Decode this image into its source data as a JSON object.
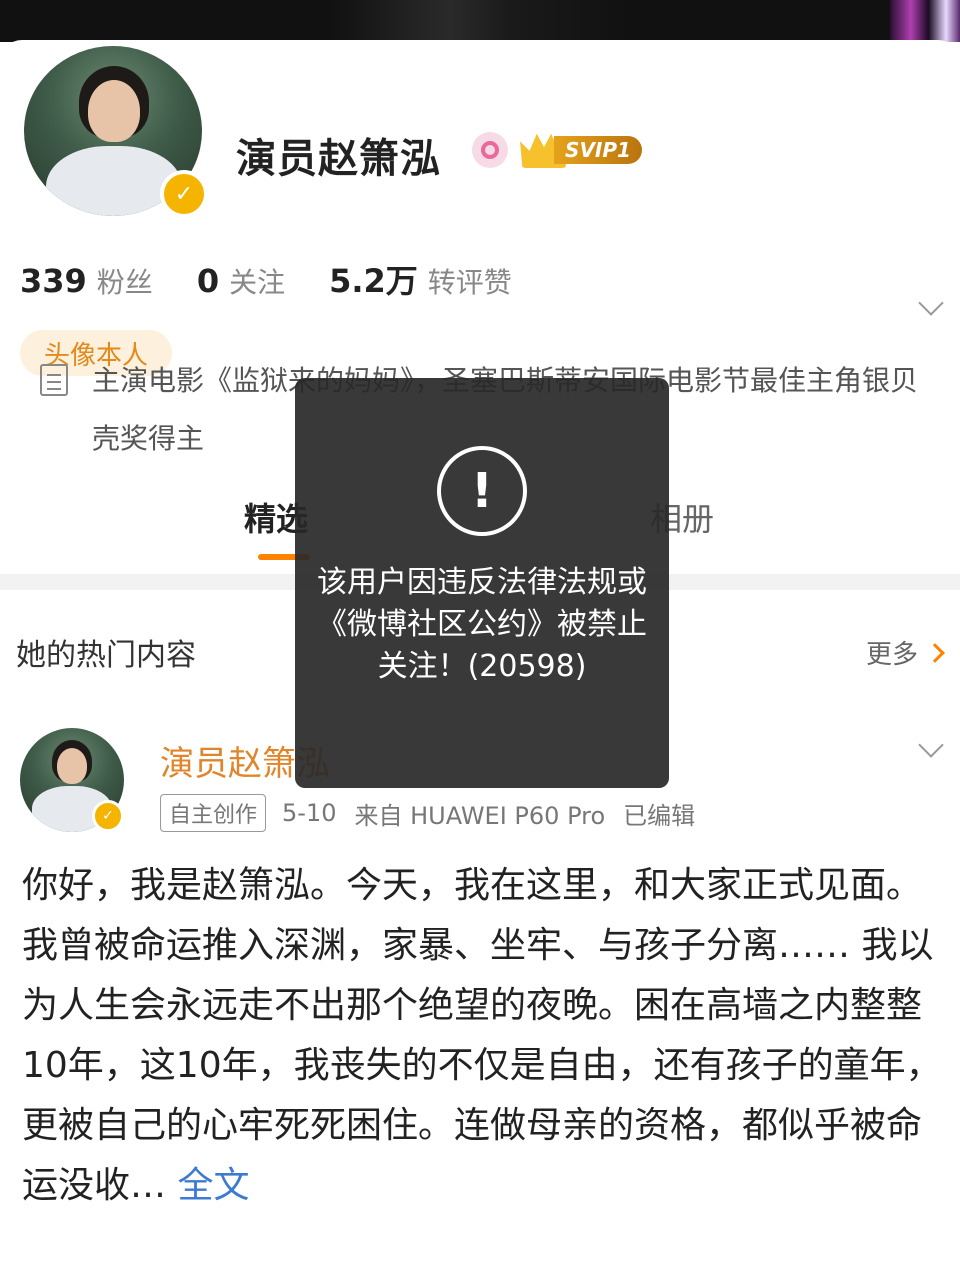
{
  "profile": {
    "username": "演员赵箫泓",
    "vip_label": "SVIP1",
    "stats": [
      {
        "num": "339",
        "label": "粉丝"
      },
      {
        "num": "0",
        "label": "关注"
      },
      {
        "num": "5.2万",
        "label": "转评赞"
      }
    ],
    "tag": "头像本人",
    "bio": "主演电影《监狱来的妈妈》，圣塞巴斯蒂安国际电影节最佳主角银贝壳奖得主"
  },
  "tabs": [
    {
      "label": "精选"
    },
    {
      "label": "相册"
    }
  ],
  "hot": {
    "title": "她的热门内容",
    "more": "更多"
  },
  "post": {
    "author": "演员赵箫泓",
    "badge": "自主创作",
    "date": "5-10",
    "source": "来自 HUAWEI P60 Pro",
    "edited": "已编辑",
    "paragraphs": [
      "你好，我是赵箫泓。今天，我在这里，和大家正式见面。",
      "我曾被命运推入深渊，家暴、坐牢、与孩子分离…… 我以为人生会永远走不出那个绝望的夜晚。困在高墙之内整整10年，这10年，我丧失的不仅是自由，还有孩子的童年，更被自己的心牢死死困住。连做母亲的资格，都似乎被命运没收…"
    ],
    "fulltext": "全文"
  },
  "toast": {
    "icon": "warning-icon",
    "message": "该用户因违反法律法规或《微博社区公约》被禁止关注！(20598)"
  },
  "colors": {
    "accent": "#ff8200",
    "author": "#e0852b",
    "link": "#3c7bd1",
    "tag_bg": "#fdf1de",
    "verified": "#f5b400"
  }
}
